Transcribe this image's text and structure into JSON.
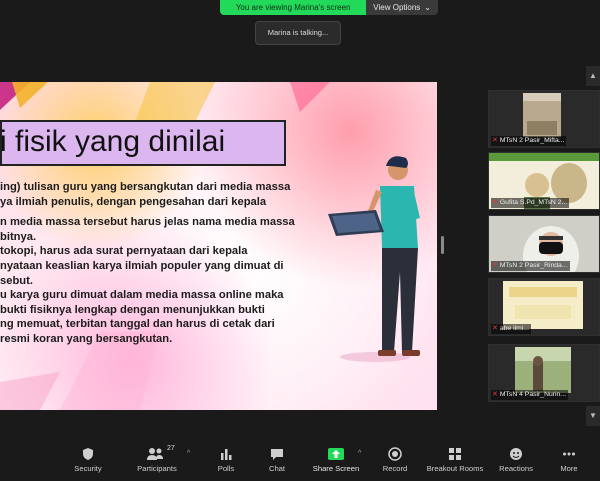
{
  "banner": {
    "viewing_text": "You are viewing Marina's screen",
    "view_options_label": "View Options",
    "accent_color": "#23d959"
  },
  "talking": "Marina is talking...",
  "slide": {
    "title": "i fisik yang dinilai",
    "lines": [
      "ing) tulisan guru yang bersangkutan dari media massa",
      "ya ilmiah penulis, dengan pengesahan dari kepala",
      "",
      "n media massa tersebut harus jelas nama media massa",
      "bitnya.",
      "tokopi, harus ada surat pernyataan dari kepala",
      "nyataan keaslian karya ilmiah populer yang dimuat di",
      "sebut.",
      "u karya guru dimuat dalam media massa online maka",
      " bukti fisiknya lengkap dengan menunjukkan bukti",
      "ng memuat, terbitan tanggal dan harus di cetak dari",
      "resmi koran yang bersangkutan."
    ]
  },
  "participants_panel": {
    "tiles": [
      {
        "name": "MTsN 2 Pasir_Mifta...",
        "icon": "mic-muted-icon"
      },
      {
        "name": "Gufita S.Pd_MTsN 2...",
        "icon": "mic-muted-icon"
      },
      {
        "name": "MTsN 2 Pasir_Rinda...",
        "icon": "mic-muted-icon"
      },
      {
        "name": "abe ilmi...",
        "icon": "mic-muted-icon"
      },
      {
        "name": "MTsN 4 Pasir_Nurin...",
        "icon": "mic-muted-icon"
      }
    ]
  },
  "toolbar": {
    "security": "Security",
    "participants": "Participants",
    "participants_count": "27",
    "polls": "Polls",
    "chat": "Chat",
    "share_screen": "Share Screen",
    "record": "Record",
    "breakout_rooms": "Breakout Rooms",
    "reactions": "Reactions",
    "more": "More"
  }
}
